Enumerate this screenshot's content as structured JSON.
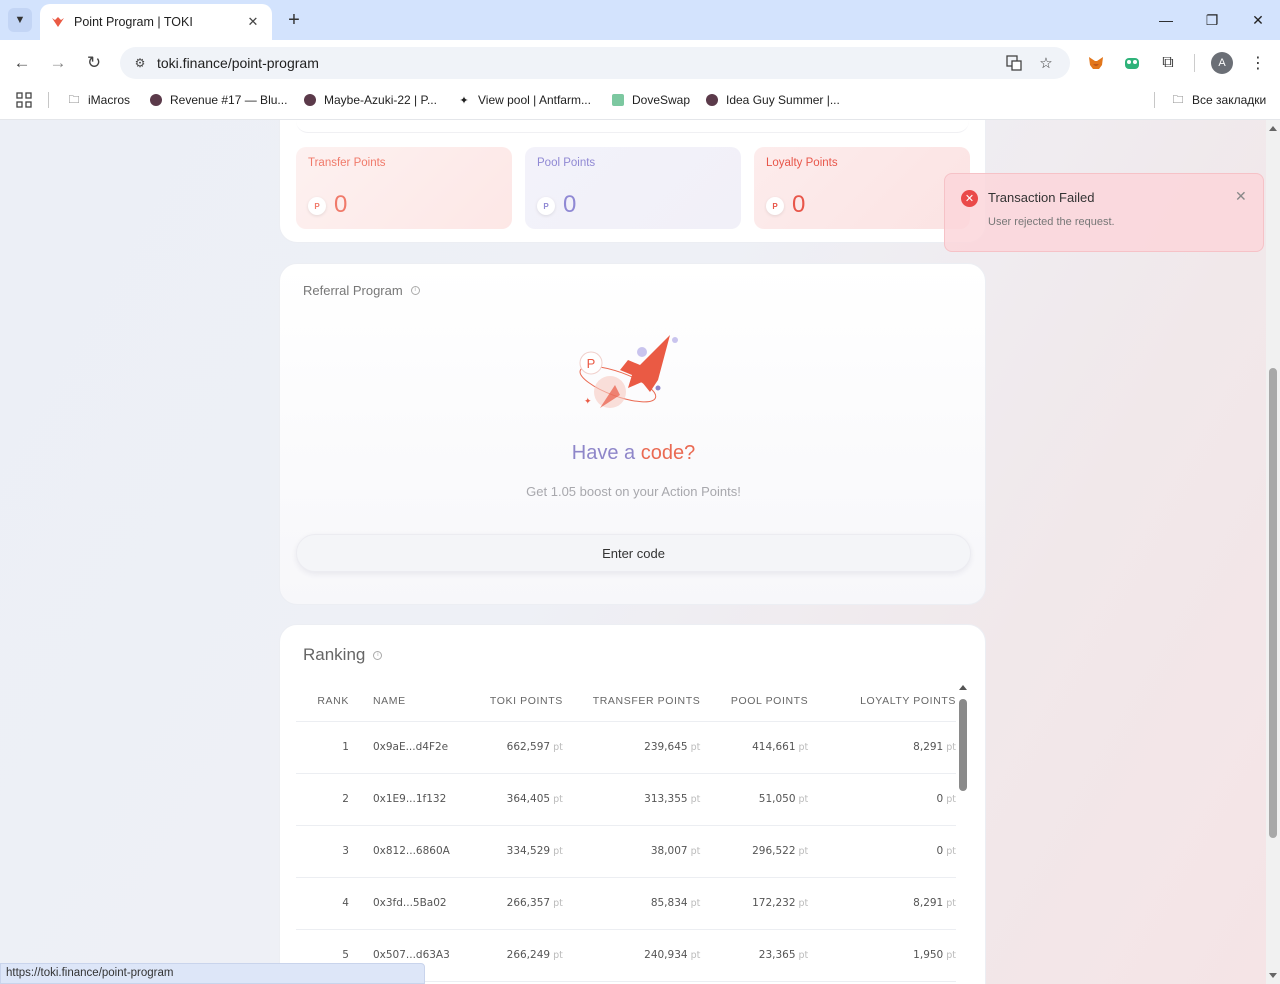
{
  "browser": {
    "tab_title": "Point Program | TOKI",
    "url": "toki.finance/point-program",
    "avatar_initial": "A",
    "bookmarks": [
      {
        "label": "iMacros",
        "icon": "folder-icon"
      },
      {
        "label": "Revenue #17 — Blu...",
        "icon": "globe-icon"
      },
      {
        "label": "Maybe-Azuki-22 | P...",
        "icon": "globe-icon"
      },
      {
        "label": "View pool | Antfarm...",
        "icon": "diamond-icon"
      },
      {
        "label": "DoveSwap",
        "icon": "dove-icon"
      },
      {
        "label": "Idea Guy Summer |...",
        "icon": "globe-icon"
      }
    ],
    "all_bookmarks_label": "Все закладки",
    "status_url": "https://toki.finance/point-program"
  },
  "points": [
    {
      "label": "Transfer Points",
      "value": "0",
      "icon_letter": "P",
      "color": "#f07a6a"
    },
    {
      "label": "Pool Points",
      "value": "0",
      "icon_letter": "P",
      "color": "#9089d4"
    },
    {
      "label": "Loyalty Points",
      "value": "0",
      "icon_letter": "P",
      "color": "#e8564a"
    }
  ],
  "referral": {
    "title": "Referral Program",
    "heading_part1": "Have a",
    "heading_part2": "code?",
    "subtitle": "Get 1.05 boost on your Action Points!",
    "button_label": "Enter code",
    "icon_letter": "P"
  },
  "ranking": {
    "title": "Ranking",
    "columns": [
      "RANK",
      "NAME",
      "TOKI POINTS",
      "TRANSFER POINTS",
      "POOL POINTS",
      "LOYALTY POINTS"
    ],
    "unit": "pt",
    "rows": [
      {
        "rank": "1",
        "name": "0x9aE...d4F2e",
        "toki": "662,597",
        "transfer": "239,645",
        "pool": "414,661",
        "loyalty": "8,291"
      },
      {
        "rank": "2",
        "name": "0x1E9...1f132",
        "toki": "364,405",
        "transfer": "313,355",
        "pool": "51,050",
        "loyalty": "0"
      },
      {
        "rank": "3",
        "name": "0x812...6860A",
        "toki": "334,529",
        "transfer": "38,007",
        "pool": "296,522",
        "loyalty": "0"
      },
      {
        "rank": "4",
        "name": "0x3fd...5Ba02",
        "toki": "266,357",
        "transfer": "85,834",
        "pool": "172,232",
        "loyalty": "8,291"
      },
      {
        "rank": "5",
        "name": "0x507...d63A3",
        "toki": "266,249",
        "transfer": "240,934",
        "pool": "23,365",
        "loyalty": "1,950"
      }
    ]
  },
  "toast": {
    "title": "Transaction Failed",
    "message": "User rejected the request.",
    "color": "#ea4a4a"
  }
}
